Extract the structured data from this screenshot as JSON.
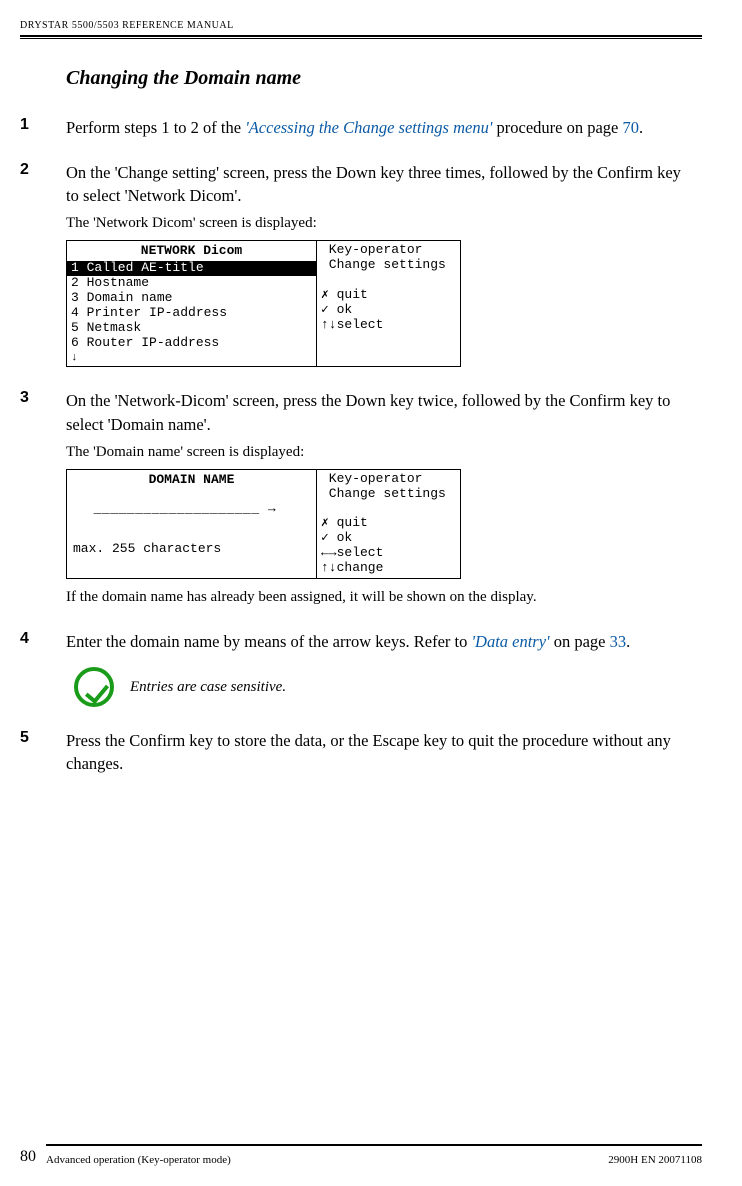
{
  "header": {
    "running_title": "DRYSTAR 5500/5503 REFERENCE MANUAL"
  },
  "section": {
    "title": "Changing the Domain name"
  },
  "steps": {
    "s1": {
      "num": "1",
      "pre": "Perform steps 1 to 2 of the ",
      "link": "'Accessing the Change settings menu'",
      "mid": " procedure on page ",
      "page": "70",
      "post": "."
    },
    "s2": {
      "num": "2",
      "text": "On the 'Change setting' screen, press the Down key three times, followed by the Confirm key to select 'Network Dicom'.",
      "sub": "The 'Network Dicom' screen is displayed:"
    },
    "s3": {
      "num": "3",
      "text": "On the 'Network-Dicom' screen, press the Down key twice, followed by the Confirm key to select 'Domain name'.",
      "sub": "The 'Domain name' screen is displayed:",
      "after": "If the domain name has already been assigned, it will be shown on the display."
    },
    "s4": {
      "num": "4",
      "pre": "Enter the domain name by means of the arrow keys. Refer to ",
      "link": "'Data entry'",
      "mid": " on page ",
      "page": "33",
      "post": "."
    },
    "note": {
      "text": "Entries are case sensitive."
    },
    "s5": {
      "num": "5",
      "text": "Press the Confirm key to store the data, or the Escape key to quit the procedure without any changes."
    }
  },
  "lcd1": {
    "title": "NETWORK Dicom",
    "items": {
      "i1": "1 Called AE-title",
      "i2": "2 Hostname",
      "i3": "3 Domain name",
      "i4": "4 Printer IP-address",
      "i5": "5 Netmask",
      "i6": "6 Router IP-address"
    },
    "arrow": "↓",
    "right": {
      "r1": " Key-operator",
      "r2": " Change settings",
      "gap": " ",
      "r3": "✗ quit",
      "r4": "✓ ok",
      "r5": "↑↓select"
    }
  },
  "lcd2": {
    "title": "DOMAIN NAME",
    "input": "  ____________________ →",
    "footer": "max. 255 characters",
    "right": {
      "r1": " Key-operator",
      "r2": " Change settings",
      "gap": " ",
      "r3": "✗ quit",
      "r4": "✓ ok",
      "r5": "←→select",
      "r6": "↑↓change"
    }
  },
  "footer": {
    "page_num": "80",
    "left": "Advanced operation (Key-operator mode)",
    "right": "2900H EN 20071108"
  }
}
